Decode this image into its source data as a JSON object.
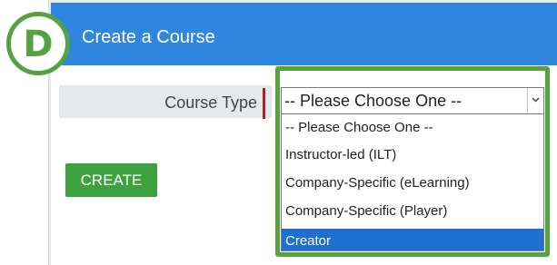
{
  "header": {
    "title": "Create a Course"
  },
  "badge": {
    "letter": "D",
    "color": "#55a340"
  },
  "form": {
    "course_type_label": "Course Type",
    "course_type_select": {
      "current_value": "-- Please Choose One --",
      "options": [
        "-- Please Choose One --",
        "Instructor-led (ILT)",
        "Company-Specific (eLearning)",
        "Company-Specific (Player)",
        "Creator"
      ],
      "highlighted_option": "Creator"
    },
    "create_button_label": "CREATE"
  },
  "colors": {
    "header_bg": "#2f86de",
    "highlight_border": "#55a340",
    "create_button_bg": "#3ea13f",
    "required_marker": "#b71c1c",
    "selected_option_bg": "#1e6fd0"
  },
  "icons": {
    "select_arrow": "chevron-down-icon"
  }
}
